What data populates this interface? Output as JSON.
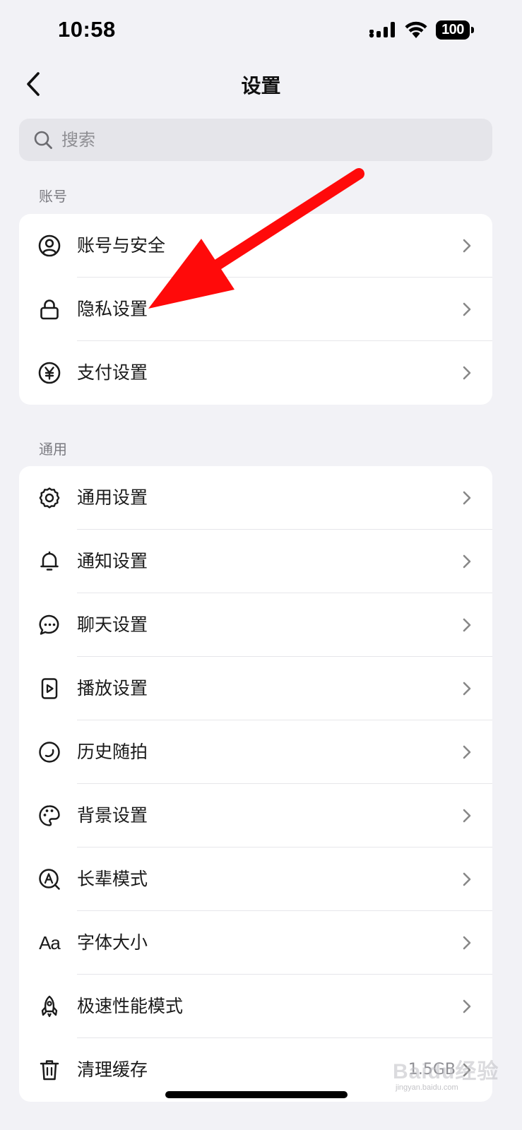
{
  "status_bar": {
    "time": "10:58",
    "battery": "100"
  },
  "nav": {
    "title": "设置"
  },
  "search": {
    "placeholder": "搜索"
  },
  "sections": {
    "account": {
      "label": "账号",
      "items": [
        {
          "label": "账号与安全",
          "icon": "user-circle-icon"
        },
        {
          "label": "隐私设置",
          "icon": "lock-icon"
        },
        {
          "label": "支付设置",
          "icon": "yen-circle-icon"
        }
      ]
    },
    "general": {
      "label": "通用",
      "items": [
        {
          "label": "通用设置",
          "icon": "gear-icon"
        },
        {
          "label": "通知设置",
          "icon": "bell-icon"
        },
        {
          "label": "聊天设置",
          "icon": "chat-bubble-icon"
        },
        {
          "label": "播放设置",
          "icon": "play-file-icon"
        },
        {
          "label": "历史随拍",
          "icon": "moment-circle-icon"
        },
        {
          "label": "背景设置",
          "icon": "palette-icon"
        },
        {
          "label": "长辈模式",
          "icon": "elder-mode-icon"
        },
        {
          "label": "字体大小",
          "icon": "font-size-icon",
          "glyph": "Aa"
        },
        {
          "label": "极速性能模式",
          "icon": "rocket-icon"
        },
        {
          "label": "清理缓存",
          "icon": "trash-icon",
          "value": "1.5GB"
        }
      ]
    }
  },
  "annotation": {
    "color": "#ff0a0a"
  },
  "watermark": {
    "text": "Baidu经验",
    "sub": "jingyan.baidu.com"
  }
}
